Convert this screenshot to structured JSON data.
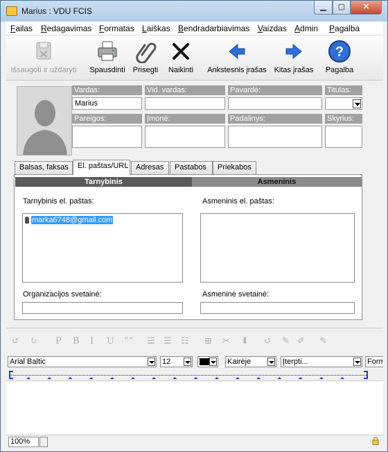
{
  "window": {
    "title": "Marius : VDU FCIS"
  },
  "menu": [
    "Failas",
    "Redagavimas",
    "Formatas",
    "Laiškas",
    "Bendradarbiavimas",
    "Vaizdas",
    "Admin",
    "Pagalba"
  ],
  "menu_mnemonics": [
    "F",
    "R",
    "F",
    "L",
    "B",
    "V",
    "A",
    "P"
  ],
  "toolbar": {
    "save_close": "Išsaugoti ir uždaryti",
    "print": "Spausdinti",
    "attach": "Prisegti",
    "delete": "Naikinti",
    "previous": "Ankstesnis įrašas",
    "next": "Kitas įrašas",
    "help": "Pagalba"
  },
  "contact": {
    "first_name_label": "Vardas:",
    "first_name": "Marius",
    "middle_name_label": "Vid. vardas:",
    "middle_name": "",
    "last_name_label": "Pavardė:",
    "last_name": "",
    "title_label": "Titulas:",
    "title_value": "",
    "position_label": "Pareigos:",
    "company_label": "Įmonė:",
    "department_label": "Padalinys:",
    "section_label": "Skyrius:"
  },
  "tabs": [
    "Balsas, faksas",
    "El. paštas/URL",
    "Adresas",
    "Pastabos",
    "Priekabos"
  ],
  "active_tab": 1,
  "email_panel": {
    "work_header": "Tarnybinis",
    "personal_header": "Asmeninis",
    "work_email_label": "Tarnybinis el. paštas:",
    "work_email_value": "marka6748@gmail.com",
    "personal_email_label": "Asmeninis el. paštas:",
    "org_website_label": "Organizacijos svetainė:",
    "personal_website_label": "Asmeninė svetainė:"
  },
  "editor": {
    "font": "Arial Baltic",
    "size": "12",
    "align": "Kairėje",
    "insert": "Įterpti...",
    "form": "Form",
    "zoom": "100%",
    "format_icons": [
      "undo-icon",
      "redo-icon",
      "paragraph-icon",
      "bold-icon",
      "italic-icon",
      "underline-icon",
      "quote-icon",
      "align-list-icon",
      "indent-icon",
      "bulleted-list-icon",
      "table-icon",
      "cut-icon",
      "paste-icon",
      "refresh-icon",
      "pen-icon",
      "brush-icon",
      "spellcheck-icon"
    ],
    "format_glyphs": [
      "↺",
      "↻",
      "P",
      "B",
      "I",
      "U",
      "“”",
      "☰",
      "☰",
      "☷",
      "⊞",
      "✂",
      "⬇",
      "↺",
      "✎",
      "✐",
      "✎"
    ]
  },
  "colors": {
    "title_bar": "#c9dff3",
    "accent": "#3399ff",
    "label_bg": "#a0a0a0",
    "active_subhead": "#5b5b5b",
    "inactive_subhead": "#8a8a8a"
  }
}
